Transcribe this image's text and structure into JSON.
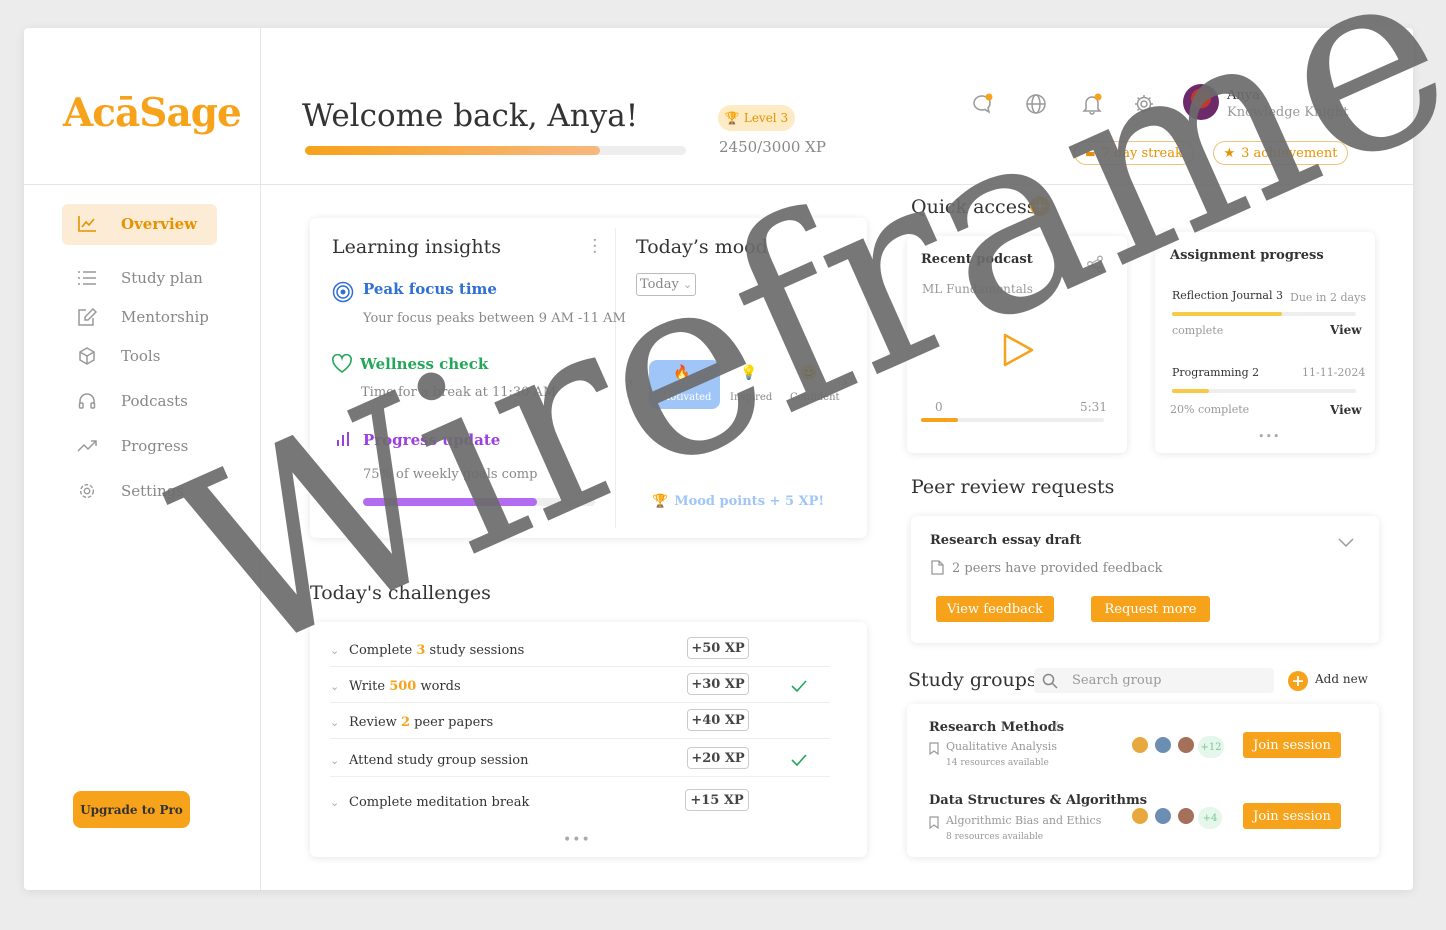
{
  "brand": {
    "logo": "AcāSage"
  },
  "header": {
    "welcome": "Welcome back, Anya!",
    "xp_progress": 0.82,
    "level": "Level 3",
    "xp_text": "2450/3000 XP",
    "user_name": "Anya",
    "user_role": "Knowledge Knight",
    "streak": "7 day streak",
    "achievement": "3 achievement",
    "icons": [
      "chat-icon",
      "globe-icon",
      "bell-icon",
      "gear-icon"
    ]
  },
  "sidebar": {
    "items": [
      {
        "label": "Overview",
        "icon": "chart-icon",
        "active": true
      },
      {
        "label": "Study plan",
        "icon": "list-icon"
      },
      {
        "label": "Mentorship",
        "icon": "edit-icon"
      },
      {
        "label": "Tools",
        "icon": "cube-icon"
      },
      {
        "label": "Podcasts",
        "icon": "headphones-icon"
      },
      {
        "label": "Progress",
        "icon": "trend-icon"
      },
      {
        "label": "Settings",
        "icon": "gear-icon"
      }
    ],
    "upgrade": "Upgrade to Pro"
  },
  "insights": {
    "title": "Learning insights",
    "peak_title": "Peak focus time",
    "peak_text": "Your focus peaks between 9 AM -11 AM",
    "wellness_title": "Wellness check",
    "wellness_text": "Time for a break at 11:30 AM",
    "progress_title": "Progress update",
    "progress_text": "75% of weekly goals comp",
    "progress_value": 0.75
  },
  "mood": {
    "title": "Today’s mood",
    "filter": "Today",
    "options": [
      "Motivated",
      "Inspired",
      "Confident"
    ],
    "footer": "Mood points + 5 XP!"
  },
  "challenges": {
    "title": "Today's challenges",
    "items": [
      {
        "pre": "Complete ",
        "num": "3",
        "post": " study sessions",
        "xp": "+50 XP",
        "done": false
      },
      {
        "pre": "Write ",
        "num": "500",
        "post": " words",
        "xp": "+30 XP",
        "done": true
      },
      {
        "pre": "Review ",
        "num": "2",
        "post": " peer papers",
        "xp": "+40 XP",
        "done": false
      },
      {
        "pre": "Attend study group session",
        "num": "",
        "post": "",
        "xp": "+20 XP",
        "done": true
      },
      {
        "pre": "Complete meditation break",
        "num": "",
        "post": "",
        "xp": "+15 XP",
        "done": false
      }
    ]
  },
  "quick_access": {
    "title": "Quick access",
    "podcast": {
      "title": "Recent podcast",
      "subtitle": "ML Fundamentals",
      "time_start": "0",
      "time_end": "5:31",
      "progress": 0.2
    },
    "assignments": {
      "title": "Assignment progress",
      "items": [
        {
          "name": "Reflection Journal 3",
          "due": "Due in 2 days",
          "status": "complete",
          "progress": 0.6,
          "action": "View"
        },
        {
          "name": "Programming 2",
          "due": "11-11-2024",
          "status": "20% complete",
          "progress": 0.2,
          "action": "View"
        }
      ]
    }
  },
  "peer_review": {
    "title": "Peer review requests",
    "item": "Research essay draft",
    "note": "2 peers have provided feedback",
    "view_btn": "View feedback",
    "request_btn": "Request more"
  },
  "groups": {
    "title": "Study groups",
    "search_placeholder": "Search group",
    "add_new": "Add new",
    "items": [
      {
        "name": "Research Methods",
        "topic": "Qualitative Analysis",
        "resources": "14 resources available",
        "extra": "+12",
        "join": "Join session"
      },
      {
        "name": "Data Structures & Algorithms",
        "topic": "Algorithmic Bias and Ethics",
        "resources": "8 resources available",
        "extra": "+4",
        "join": "Join session"
      }
    ]
  },
  "watermark": "Wireframe",
  "colors": {
    "accent": "#f7a21b",
    "blue": "#2f6fd6",
    "green": "#26a65b",
    "purple": "#9b40e0"
  }
}
